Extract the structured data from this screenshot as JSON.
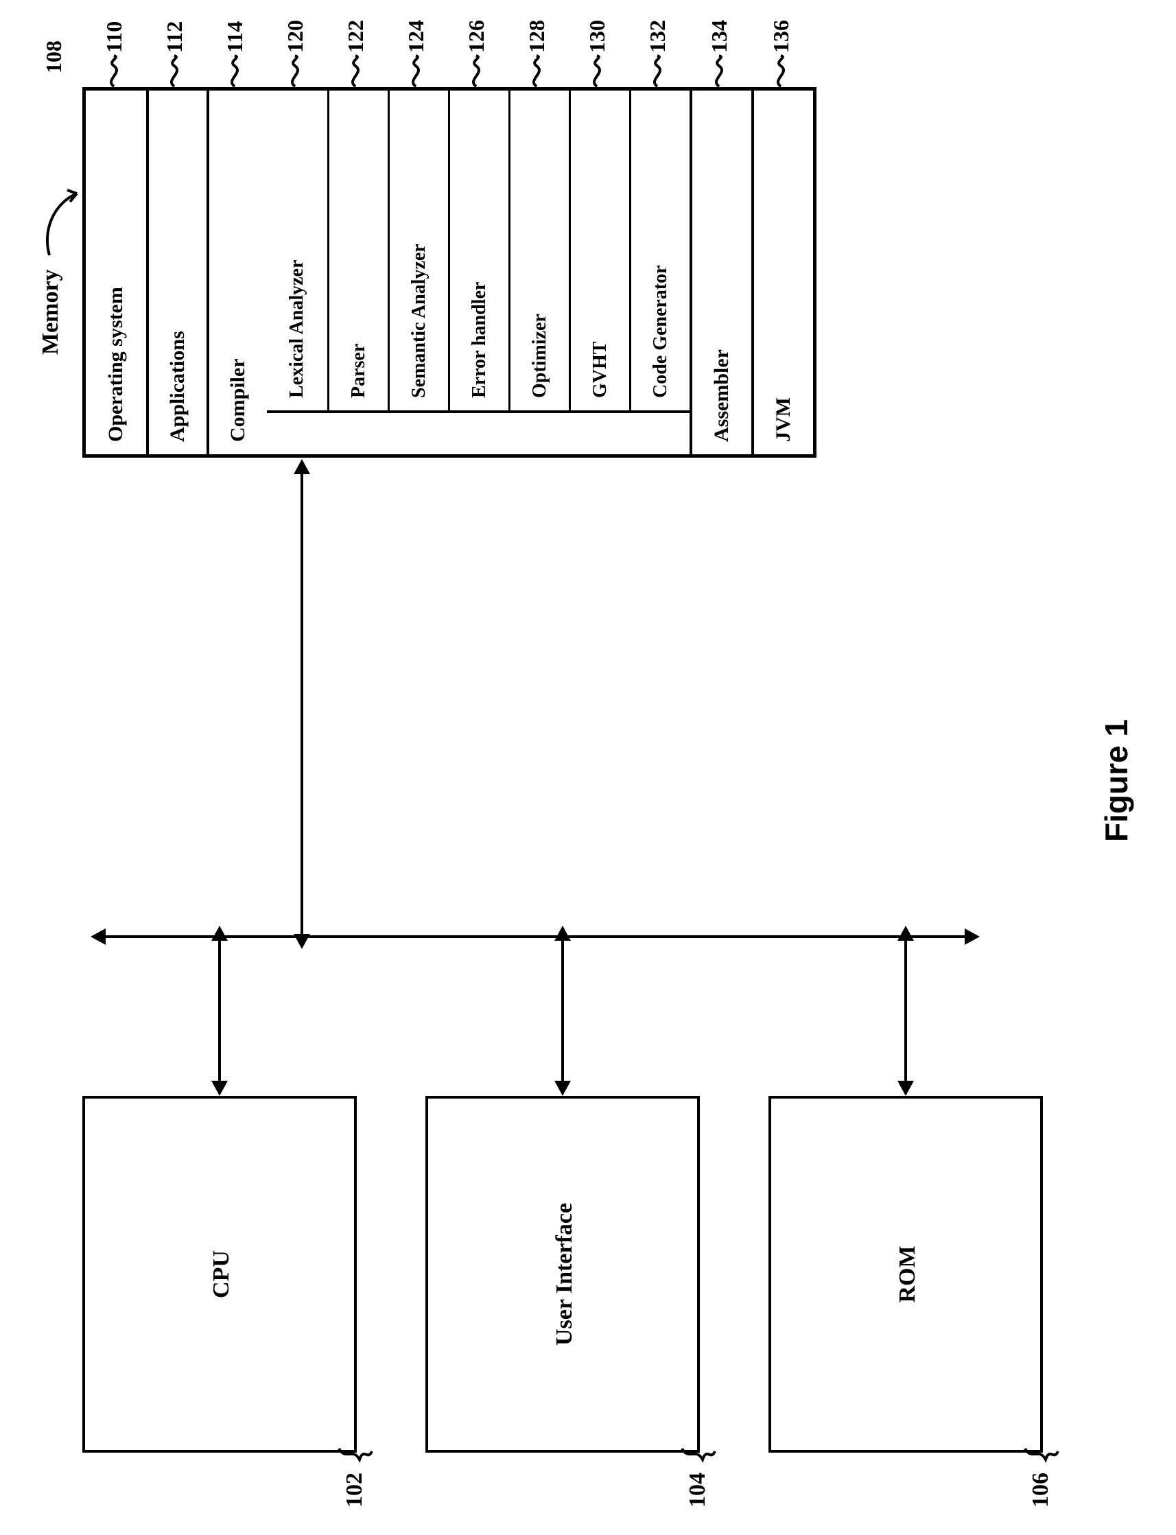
{
  "figure_caption": "Figure 1",
  "left_blocks": {
    "cpu": {
      "label": "CPU",
      "ref": "102"
    },
    "ui": {
      "label": "User Interface",
      "ref": "104"
    },
    "rom": {
      "label": "ROM",
      "ref": "106"
    }
  },
  "memory": {
    "title": "Memory",
    "ref": "108",
    "rows": [
      {
        "label": "Operating system",
        "ref": "110"
      },
      {
        "label": "Applications",
        "ref": "112"
      },
      {
        "label": "Compiler",
        "ref": "114"
      },
      {
        "label": "Assembler",
        "ref": "134"
      },
      {
        "label": "JVM",
        "ref": "136"
      }
    ],
    "compiler_sub": [
      {
        "label": "Lexical Analyzer",
        "ref": "120"
      },
      {
        "label": "Parser",
        "ref": "122"
      },
      {
        "label": "Semantic Analyzer",
        "ref": "124"
      },
      {
        "label": "Error handler",
        "ref": "126"
      },
      {
        "label": "Optimizer",
        "ref": "128"
      },
      {
        "label": "GVHT",
        "ref": "130"
      },
      {
        "label": "Code Generator",
        "ref": "132"
      }
    ]
  }
}
